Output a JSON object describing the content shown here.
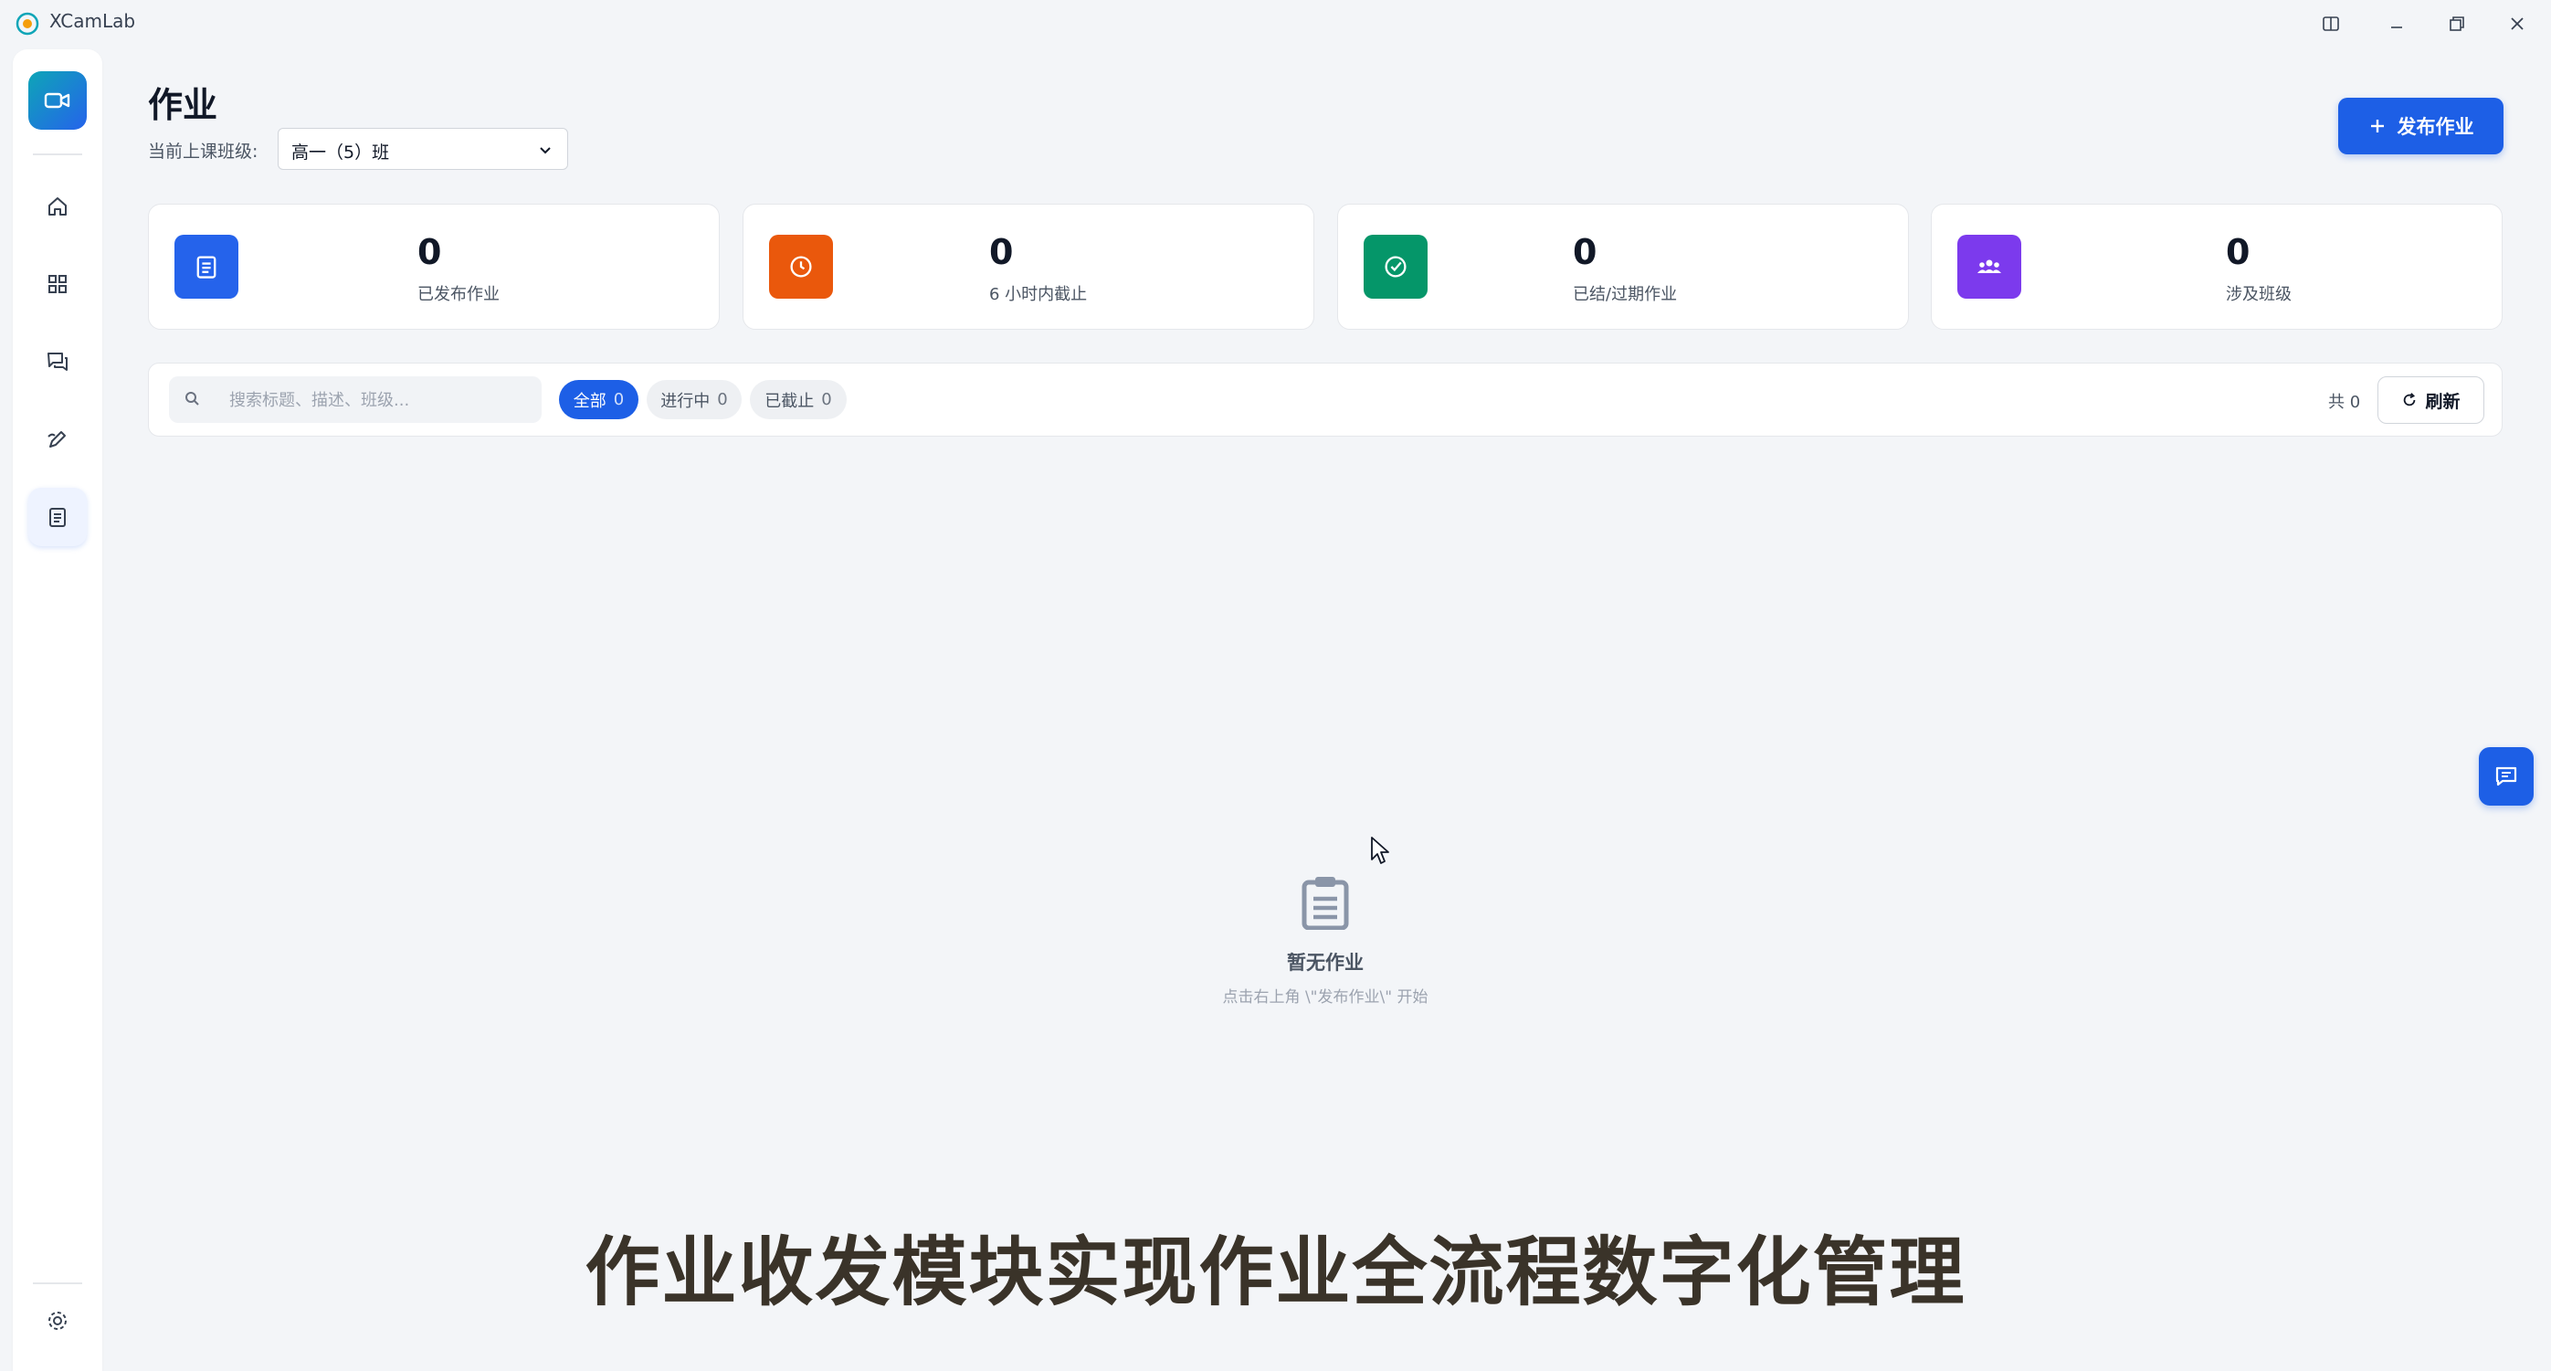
{
  "window": {
    "title": "XCamLab"
  },
  "header": {
    "title": "作业",
    "class_label": "当前上课班级:",
    "class_selected": "高一（5）班",
    "publish_button": "发布作业"
  },
  "stats": [
    {
      "value": "0",
      "label": "已发布作业",
      "color": "#2563eb",
      "icon": "clipboard-icon"
    },
    {
      "value": "0",
      "label": "6 小时内截止",
      "color": "#ea580c",
      "icon": "clock-icon"
    },
    {
      "value": "0",
      "label": "已结/过期作业",
      "color": "#059669",
      "icon": "check-circle-icon"
    },
    {
      "value": "0",
      "label": "涉及班级",
      "color": "#7c3aed",
      "icon": "users-icon"
    }
  ],
  "filter": {
    "search_placeholder": "搜索标题、描述、班级...",
    "pills": [
      {
        "label": "全部",
        "count": "0",
        "active": true
      },
      {
        "label": "进行中",
        "count": "0",
        "active": false
      },
      {
        "label": "已截止",
        "count": "0",
        "active": false
      }
    ],
    "total": "共 0",
    "refresh": "刷新"
  },
  "empty": {
    "title": "暂无作业",
    "subtitle": "点击右上角 \\\"发布作业\\\" 开始"
  },
  "caption": "作业收发模块实现作业全流程数字化管理",
  "sidebar": {
    "items": [
      "home-icon",
      "grid-icon",
      "chat-icon",
      "pen-icon",
      "clipboard-icon"
    ],
    "active": "clipboard-icon",
    "bottom": "gear-icon"
  },
  "colors": {
    "accent": "#1d5fe6",
    "background": "#f3f5f8"
  }
}
